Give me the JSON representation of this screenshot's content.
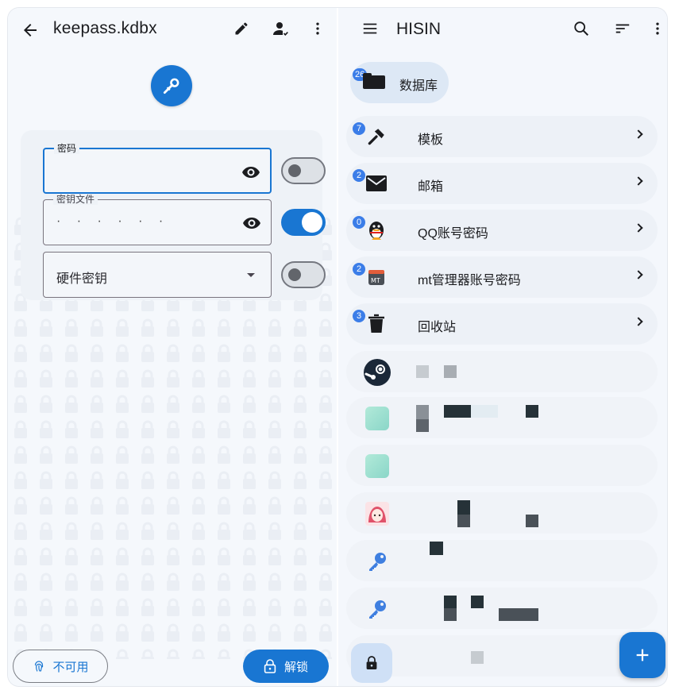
{
  "left": {
    "title": "keepass.kdbx",
    "fields": {
      "password_label": "密码",
      "password_value": "",
      "keyfile_label": "密钥文件",
      "keyfile_value": "· · · · · ·",
      "hardware_label": "硬件密钥"
    },
    "switches": {
      "password_on": false,
      "keyfile_on": true,
      "hardware_on": false
    },
    "buttons": {
      "unavailable": "不可用",
      "unlock": "解锁"
    },
    "icons": [
      "back-arrow-icon",
      "edit-pencil-icon",
      "person-check-icon",
      "more-vert-icon",
      "key-pencil-icon",
      "eye-icon",
      "fingerprint-icon",
      "lock-icon"
    ]
  },
  "right": {
    "title": "HISIN",
    "database_chip": {
      "label": "数据库",
      "badge": "26"
    },
    "groups": [
      {
        "label": "模板",
        "badge": "7",
        "icon": "hammer-icon"
      },
      {
        "label": "邮箱",
        "badge": "2",
        "icon": "envelope-icon"
      },
      {
        "label": "QQ账号密码",
        "badge": "0",
        "icon": "qq-penguin-icon"
      },
      {
        "label": "mt管理器账号密码",
        "badge": "2",
        "icon": "mt-manager-icon"
      },
      {
        "label": "回收站",
        "badge": "3",
        "icon": "trash-icon"
      }
    ],
    "entries": [
      "steam-icon",
      "teal-app-icon",
      "teal-app-icon",
      "anime-avatar-icon",
      "key-icon",
      "key-icon",
      "key-icon"
    ],
    "icons": [
      "menu-icon",
      "search-icon",
      "sort-icon",
      "more-vert-icon",
      "add-icon",
      "lock-icon"
    ]
  },
  "colors": {
    "accent": "#1976d2",
    "badge": "#3b7de8",
    "background": "#f4f7fc"
  }
}
